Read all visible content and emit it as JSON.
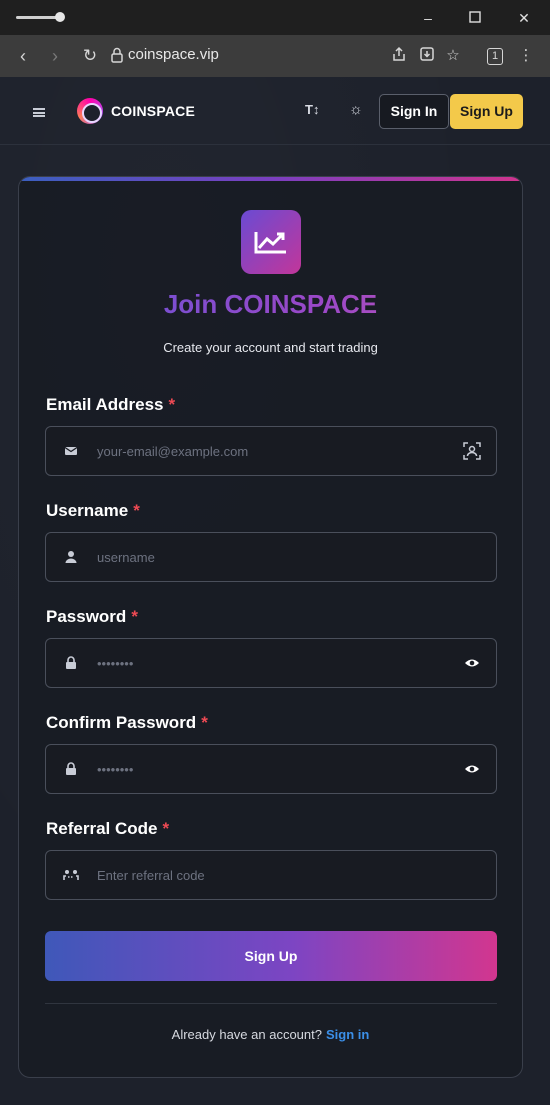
{
  "browser": {
    "url": "coinspace.vip",
    "tab_count": "1"
  },
  "header": {
    "brand": "COINSPACE",
    "text_size_label": "T↕",
    "sign_in": "Sign In",
    "sign_up": "Sign Up"
  },
  "card": {
    "title": "Join COINSPACE",
    "subtitle": "Create your account and start trading",
    "fields": {
      "email": {
        "label": "Email Address",
        "required": "*",
        "placeholder": "your-email@example.com"
      },
      "username": {
        "label": "Username",
        "required": "*",
        "placeholder": "username"
      },
      "password": {
        "label": "Password",
        "required": "*",
        "placeholder": "••••••••"
      },
      "confirm": {
        "label": "Confirm Password",
        "required": "*",
        "placeholder": "••••••••"
      },
      "referral": {
        "label": "Referral Code",
        "required": "*",
        "placeholder": "Enter referral code"
      }
    },
    "submit": "Sign Up",
    "footer_prompt": "Already have an account?",
    "footer_link": "Sign in"
  },
  "colors": {
    "accent_yellow": "#f3c94a",
    "link_blue": "#3b8fe8",
    "required_red": "#ef4a54"
  }
}
